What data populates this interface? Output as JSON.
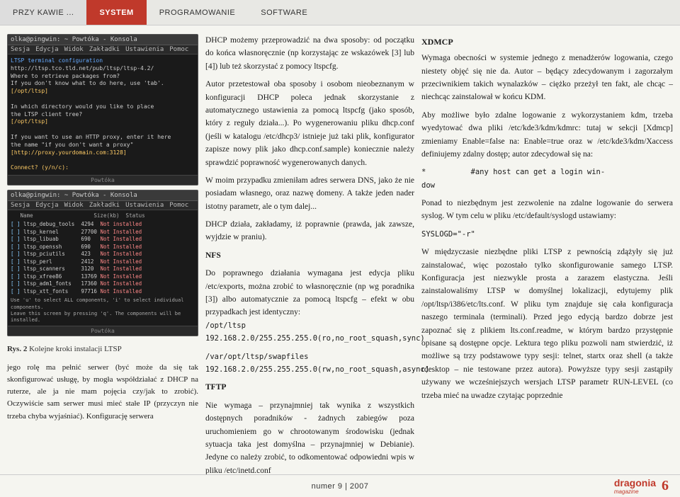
{
  "nav": {
    "items": [
      {
        "label": "PRZY KAWIE ...",
        "active": false
      },
      {
        "label": "SYSTEM",
        "active": true
      },
      {
        "label": "PROGRAMOWANIE",
        "active": false
      },
      {
        "label": "SOFTWARE",
        "active": false
      }
    ]
  },
  "screenshots": {
    "screen1": {
      "title": "olka@pingwin: ~ Powtóka - Konsola",
      "menu": [
        "Sesja",
        "Edycja",
        "Widok",
        "Zakładki",
        "Ustawienia",
        "Pomoc"
      ],
      "content_lines": [
        "LTSP terminal configuration",
        "http://ltsp.tco.tld.net/pub/ltsp/ltsp-4.2/",
        "Where to retrieve packages from?",
        "If you don't know what to do here, use 'tab'.",
        "[/opt/ltsp]",
        "",
        "In which directory would you like to place the LTSP client tree?",
        "[/opt/ltsp]",
        "",
        "If you want to use an HTTP proxy, enter it here",
        "the name \"If you don't want a proxy\"",
        "[http://proxy.yourdomain.com:3128]",
        "",
        "",
        "Connect? (y/n/c):"
      ],
      "footer": "Powtóka"
    },
    "screen2": {
      "title": "olka@pingwin: ~ Powtóka - Konsola",
      "menu": [
        "Sesja",
        "Edycja",
        "Widok",
        "Zakładki",
        "Ustawienia",
        "Pomoc"
      ],
      "table_header": "     Name                    Size (kb)  Status",
      "table_rows": [
        {
          "name": "ltsp_debug_tools",
          "size": "4294",
          "status": "Not Installed"
        },
        {
          "name": "ltsp_kernel",
          "size": "27700",
          "status": "Not Installed"
        },
        {
          "name": "ltsp_libuab",
          "size": "690",
          "status": "Not Installed"
        },
        {
          "name": "ltsp_openssh",
          "size": "690",
          "status": "Not Installed"
        },
        {
          "name": "ltsp_pciutils",
          "size": "423",
          "status": "Not Installed"
        },
        {
          "name": "ltsp_perl",
          "size": "2412",
          "status": "Not Installed"
        },
        {
          "name": "ltsp_scanners",
          "size": "3120",
          "status": "Not Installed"
        },
        {
          "name": "ltsp_xfree86",
          "size": "13769",
          "status": "Not Installed"
        },
        {
          "name": "ltsp_adm1_fonts",
          "size": "17360",
          "status": "Not Installed"
        },
        {
          "name": "ltsp_xtt_fonts",
          "size": "97716",
          "status": "Not Installed"
        }
      ],
      "hint_lines": [
        "Use 'u' to select ALL components, 'i' to select individual components.",
        "Leave this screen by pressing 'q'. The components will be installed."
      ],
      "footer": "Powtóka"
    }
  },
  "figure_caption": {
    "label": "Rys. 2",
    "text": "Kolejne kroki instalacji LTSP"
  },
  "body_caption": "jego rolę ma pełnić serwer (być może da się tak skonfigurować usługę, by mogła współdziałać z DHCP na ruterze, ale ja nie mam pojęcia czy/jak to zrobić). Oczywiście sam serwer musi mieć stałe IP (przyczyn nie trzeba chyba wyjaśniać). Konfigurację serwera",
  "middle_article": {
    "paragraphs": [
      "DHCP możemy przeprowadzić na dwa sposoby: od początku do końca własnoręcznie (np korzystając ze wskazówek [3] lub [4]) lub też skorzystać z pomocy ltspcfg.",
      "Autor przetestował oba sposoby i osobom nieobeznanym w konfiguracji DHCP poleca jednak skorzystanie z automatycznego ustawienia za pomocą ltspcfg (jako sposób, który z reguły działa...). Po wygenerowaniu pliku dhcp.conf (jeśli w katalogu /etc/dhcp3/ istnieje już taki plik, konfigurator zapisze nowy plik jako dhcp.conf.sample) koniecznie należy sprawdzić poprawność wygenerowanych danych.",
      "W moim przypadku zmieniłam adres serwera DNS, jako że nie posiadam własnego, oraz nazwę domeny. A także jeden nader istotny parametr, ale o tym dalej...",
      "DHCP działa, zakładamy, iż poprawnie (prawda, jak zawsze, wyjdzie w praniu).",
      "NFS",
      "Do poprawnego działania wymagana jest edycja pliku /etc/exports, można zrobić to własnoręcznie (np wg poradnika [3]) albo automatycznie za pomocą ltspcfg – efekt w obu przypadkach jest identyczny: /opt/ltsp  192.168.2.0/255.255.255.0(ro,no_root_squash,sync)",
      "/var/opt/ltsp/swapfiles 192.168.2.0/255.255.255.0(rw,no_root_squash,async)",
      "TFTP",
      "Nie wymaga – przynajmniej tak wynika z wszystkich dostępnych poradników - żadnych zabiegów poza uruchomieniem go w chrootowanym środowisku (jednak sytuacja taka jest domyślna – przynajmniej w Debianie). Jedyne co należy zrobić, to odkomentować odpowiedni wpis w pliku /etc/inetd.conf"
    ]
  },
  "right_article": {
    "section1_title": "XDMCP",
    "section1_paragraphs": [
      "Wymaga obecności w systemie jednego z menadżerów logowania, czego niestety objęć się nie da. Autor – będący zdecydowanym i zagorzałym przeciwnikiem takich wynalazków – ciężko przeżył ten fakt, ale chcąc – niechcąc zainstalował w końcu KDM.",
      "Aby możliwe było zdalne logowanie z wykorzystaniem kdm, trzeba wyedytować dwa pliki /etc/kde3/kdm/kdmrc: tutaj w sekcji [Xdmcp] zmieniamy Enable=false na: Enable=true oraz w /etc/kde3/kdm/Xaccess definiujemy zdalny dostęp; autor zdecydował się na:",
      "*          #any host can get a login window",
      "Ponad to niezbędnym jest zezwolenie na zdalne logowanie do serwera syslog. W tym celu w pliku /etc/default/syslogd ustawiamy:",
      "SYSLOGD=\"-r\""
    ],
    "section2_paragraphs": [
      "W międzyczasie niezbędne pliki LTSP z pewnością zdążyły się już zainstalować, więc pozostało tylko skonfigurowanie samego LTSP. Konfiguracja jest niezwykle prosta a zarazem elastyczna. Jeśli zainstalowaliśmy LTSP w domyślnej lokalizacji, edytujemy plik /opt/ltsp/i386/etc/lts.conf. W pliku tym znajduje się cała konfiguracja naszego terminala (terminali). Przed jego edycją bardzo dobrze jest zapoznać się z plikiem lts.conf.readme, w którym bardzo przystępnie opisane są dostępne opcje. Lektura tego pliku pozwoli nam stwierdzić, iż możliwe są trzy podstawowe typy sesji: telnet, startx oraz shell (a także rdesktop – nie testowane przez autora). Powyższe typy sesji zastąpiły używany we wcześniejszych wersjach LTSP parametr RUN-LEVEL (co trzeba mieć na uwadze czytając poprzednie"
    ]
  },
  "footer": {
    "center_text": "numer 9 | 2007",
    "page_number": "6",
    "logo_text": "dragonia",
    "logo_sub": "magazine"
  }
}
